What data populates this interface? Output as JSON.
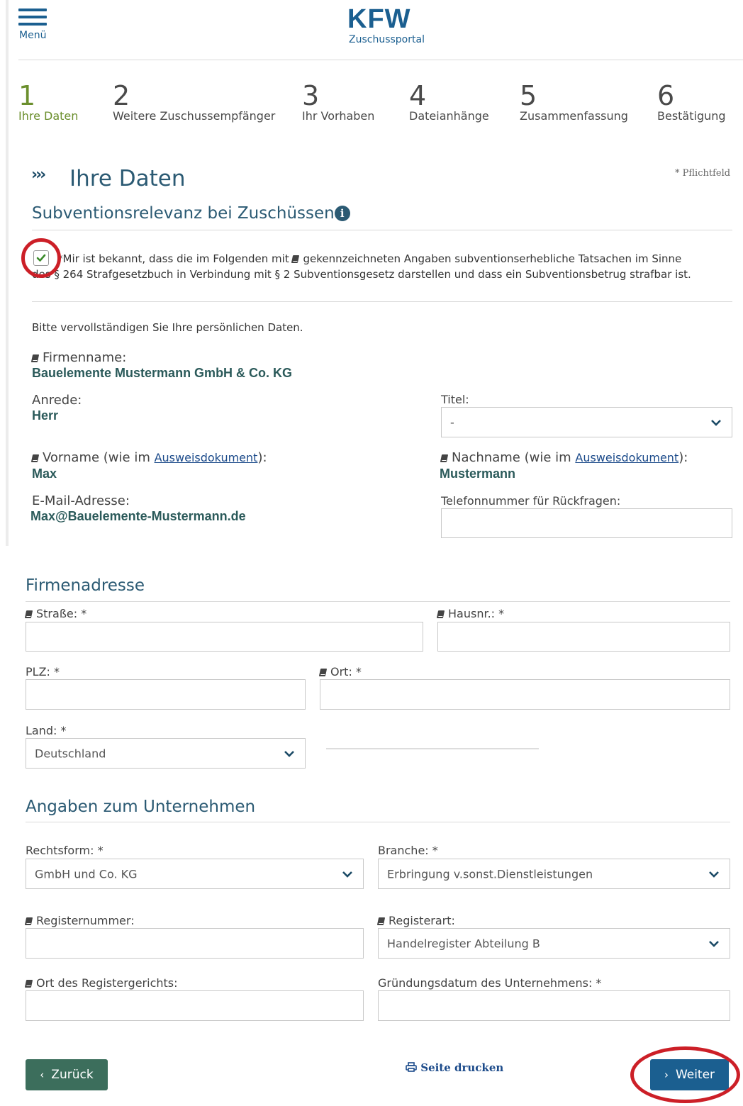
{
  "header": {
    "menu_label": "Menü",
    "logo": "KFW",
    "logo_sub": "Zuschussportal"
  },
  "steps": [
    {
      "num": "1",
      "label": "Ihre Daten",
      "active": true
    },
    {
      "num": "2",
      "label": "Weitere Zuschussempfänger",
      "active": false
    },
    {
      "num": "3",
      "label": "Ihr Vorhaben",
      "active": false
    },
    {
      "num": "4",
      "label": "Dateianhänge",
      "active": false
    },
    {
      "num": "5",
      "label": "Zusammenfassung",
      "active": false
    },
    {
      "num": "6",
      "label": "Bestätigung",
      "active": false
    }
  ],
  "page": {
    "chevrons": "›››",
    "title": "Ihre Daten",
    "required_note": "* Pflichtfeld"
  },
  "subvention": {
    "title": "Subventionsrelevanz bei Zuschüssen",
    "info_icon": "i",
    "checked": true,
    "text_part1": "*Mir ist bekannt, dass die im Folgenden mit",
    "text_part2": "gekennzeichneten Angaben subventionserhebliche Tatsachen im Sinne",
    "text_line2": "des § 264 Strafgesetzbuch in Verbindung mit § 2 Subventionsgesetz darstellen und dass ein Subventionsbetrug strafbar ist."
  },
  "personal": {
    "intro": "Bitte vervollständigen Sie Ihre persönlichen Daten.",
    "firmenname_label": "Firmenname:",
    "firmenname_value": "Bauelemente Mustermann GmbH & Co. KG",
    "anrede_label": "Anrede:",
    "anrede_value": "Herr",
    "titel_label": "Titel:",
    "titel_value": "-",
    "vorname_label_pre": "Vorname (wie im ",
    "vorname_link": "Ausweisdokument",
    "vorname_label_post": "):",
    "vorname_value": "Max",
    "nachname_label_pre": "Nachname (wie im ",
    "nachname_link": "Ausweisdokument",
    "nachname_label_post": "):",
    "nachname_value": "Mustermann",
    "email_label": "E-Mail-Adresse:",
    "email_value": "Max@Bauelemente-Mustermann.de",
    "phone_label": "Telefonnummer für Rückfragen:",
    "phone_value": ""
  },
  "address": {
    "title": "Firmenadresse",
    "strasse_label": "Straße: *",
    "hausnr_label": "Hausnr.: *",
    "plz_label": "PLZ: *",
    "ort_label": "Ort: *",
    "land_label": "Land: *",
    "land_value": "Deutschland"
  },
  "company": {
    "title": "Angaben zum Unternehmen",
    "rechtsform_label": "Rechtsform: *",
    "rechtsform_value": "GmbH und Co. KG",
    "branche_label": "Branche: *",
    "branche_value": "Erbringung v.sonst.Dienstleistungen",
    "registernummer_label": "Registernummer:",
    "registerart_label": "Registerart:",
    "registerart_value": "Handelregister Abteilung B",
    "registergericht_label": "Ort des Registergerichts:",
    "gruendung_label": "Gründungsdatum des Unternehmens: *"
  },
  "footer": {
    "back_label": "Zurück",
    "print_label": "Seite drucken",
    "next_label": "Weiter"
  },
  "colors": {
    "primary": "#1b5f90",
    "active_step": "#6b8f2d",
    "back_button": "#3c6e5c",
    "highlight": "#cc1f27"
  }
}
